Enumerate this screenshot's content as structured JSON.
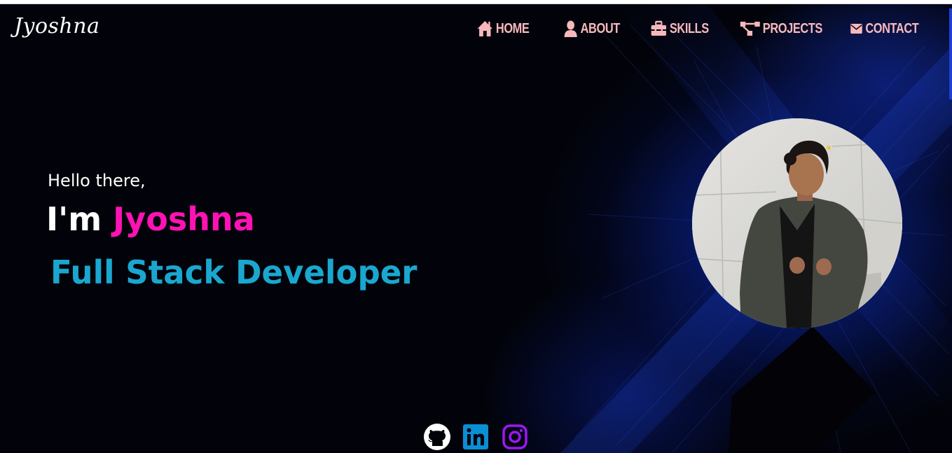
{
  "brand": {
    "logo_text": "Jyoshna"
  },
  "nav": {
    "items": [
      {
        "label": "HOME",
        "icon": "home-icon"
      },
      {
        "label": "ABOUT",
        "icon": "user-icon"
      },
      {
        "label": "SKILLS",
        "icon": "toolbox-icon"
      },
      {
        "label": "PROJECTS",
        "icon": "project-diagram-icon"
      },
      {
        "label": "CONTACT",
        "icon": "envelope-icon"
      }
    ]
  },
  "hero": {
    "greeting": "Hello there,",
    "intro_prefix": "I'm",
    "name": "Jyoshna",
    "role": "Full Stack Developer"
  },
  "social": {
    "items": [
      {
        "icon": "github-icon"
      },
      {
        "icon": "linkedin-icon"
      },
      {
        "icon": "instagram-icon"
      }
    ]
  },
  "colors": {
    "nav_text": "#f7b8bc",
    "name_accent": "#ff12b4",
    "role_accent": "#1aa7cf",
    "background": "#02030a",
    "glow_blue": "#1234be"
  }
}
